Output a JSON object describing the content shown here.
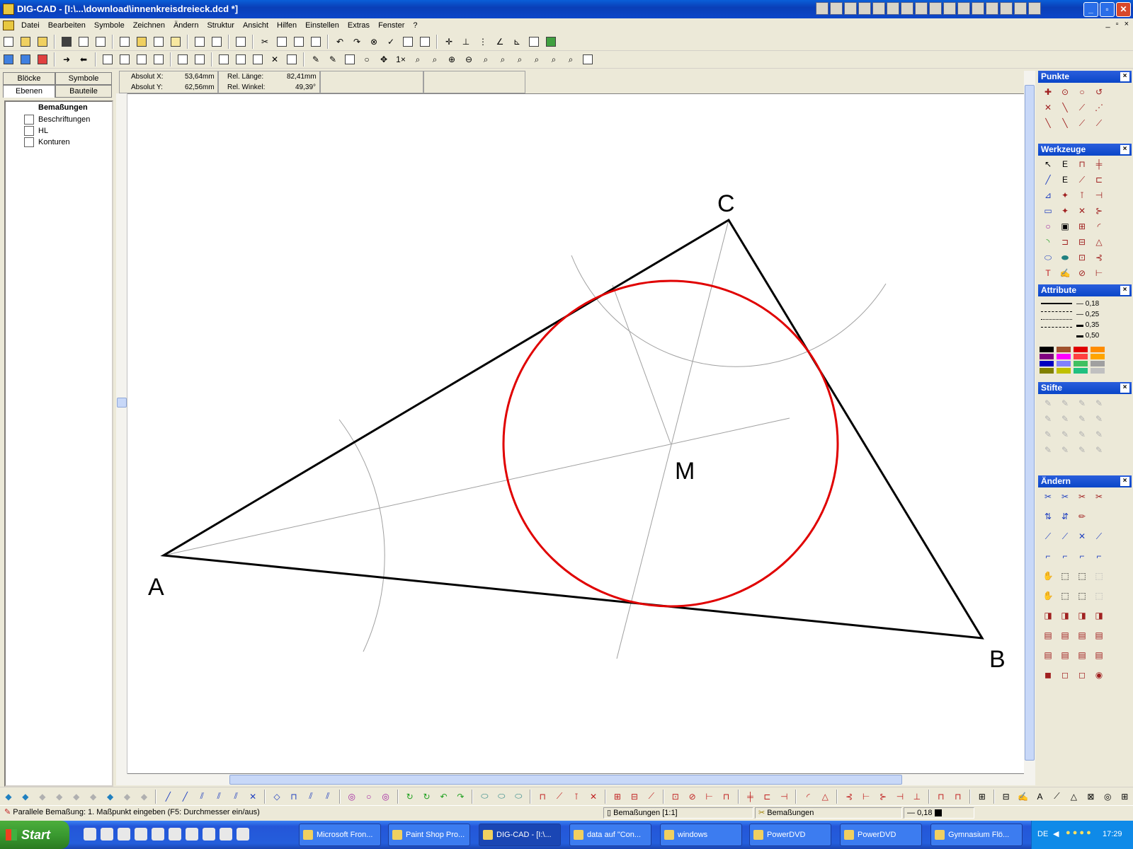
{
  "window": {
    "title": "DIG-CAD - [I:\\...\\download\\innenkreisdreieck.dcd *]",
    "minimize": "_",
    "maximize": "▫",
    "close": "✕"
  },
  "menu": [
    "Datei",
    "Bearbeiten",
    "Symbole",
    "Zeichnen",
    "Ändern",
    "Struktur",
    "Ansicht",
    "Hilfen",
    "Einstellen",
    "Extras",
    "Fenster",
    "?"
  ],
  "mdi_controls": [
    "_",
    "▫",
    "×"
  ],
  "left_panel": {
    "tabs_top": [
      "Blöcke",
      "Symbole"
    ],
    "tabs_bottom": [
      "Ebenen",
      "Bauteile"
    ],
    "layers": [
      "Bemaßungen",
      "Beschriftungen",
      "HL",
      "Konturen"
    ]
  },
  "coords": {
    "abs_x_label": "Absolut X:",
    "abs_x_value": "53,64mm",
    "abs_y_label": "Absolut Y:",
    "abs_y_value": "62,56mm",
    "rel_len_label": "Rel. Länge:",
    "rel_len_value": "82,41mm",
    "rel_angle_label": "Rel. Winkel:",
    "rel_angle_value": "49,39°"
  },
  "drawing": {
    "labels": {
      "A": "A",
      "B": "B",
      "C": "C",
      "M": "M"
    },
    "triangle_color": "#000000",
    "incircle_color": "#e00000",
    "construction_color": "#a0a0a0"
  },
  "right_panels": {
    "punkte": "Punkte",
    "werkzeuge": "Werkzeuge",
    "attribute": "Attribute",
    "stifte": "Stifte",
    "aendern": "Ändern",
    "line_widths": [
      "0,18",
      "0,25",
      "0,35",
      "0,50"
    ],
    "palette": [
      "#000000",
      "#a0522d",
      "#e00000",
      "#ff8c00",
      "#800080",
      "#ff00ff",
      "#ff4040",
      "#ffa500",
      "#0000c0",
      "#8080ff",
      "#40c060",
      "#a0a0a0",
      "#808000",
      "#c0c000",
      "#20c080",
      "#c0c0c0"
    ]
  },
  "statusbar": {
    "message": "Parallele Bemaßung: 1. Maßpunkt eingeben (F5: Durchmesser ein/aus)",
    "layer_scale": "Bemaßungen [1:1]",
    "layer": "Bemaßungen",
    "linewidth": "0,18"
  },
  "taskbar": {
    "start": "Start",
    "items": [
      "Microsoft Fron...",
      "Paint Shop Pro...",
      "DIG-CAD - [I:\\...",
      "data auf \"Con...",
      "windows",
      "PowerDVD",
      "PowerDVD",
      "Gymnasium Flö..."
    ],
    "lang": "DE",
    "clock": "17:29"
  }
}
